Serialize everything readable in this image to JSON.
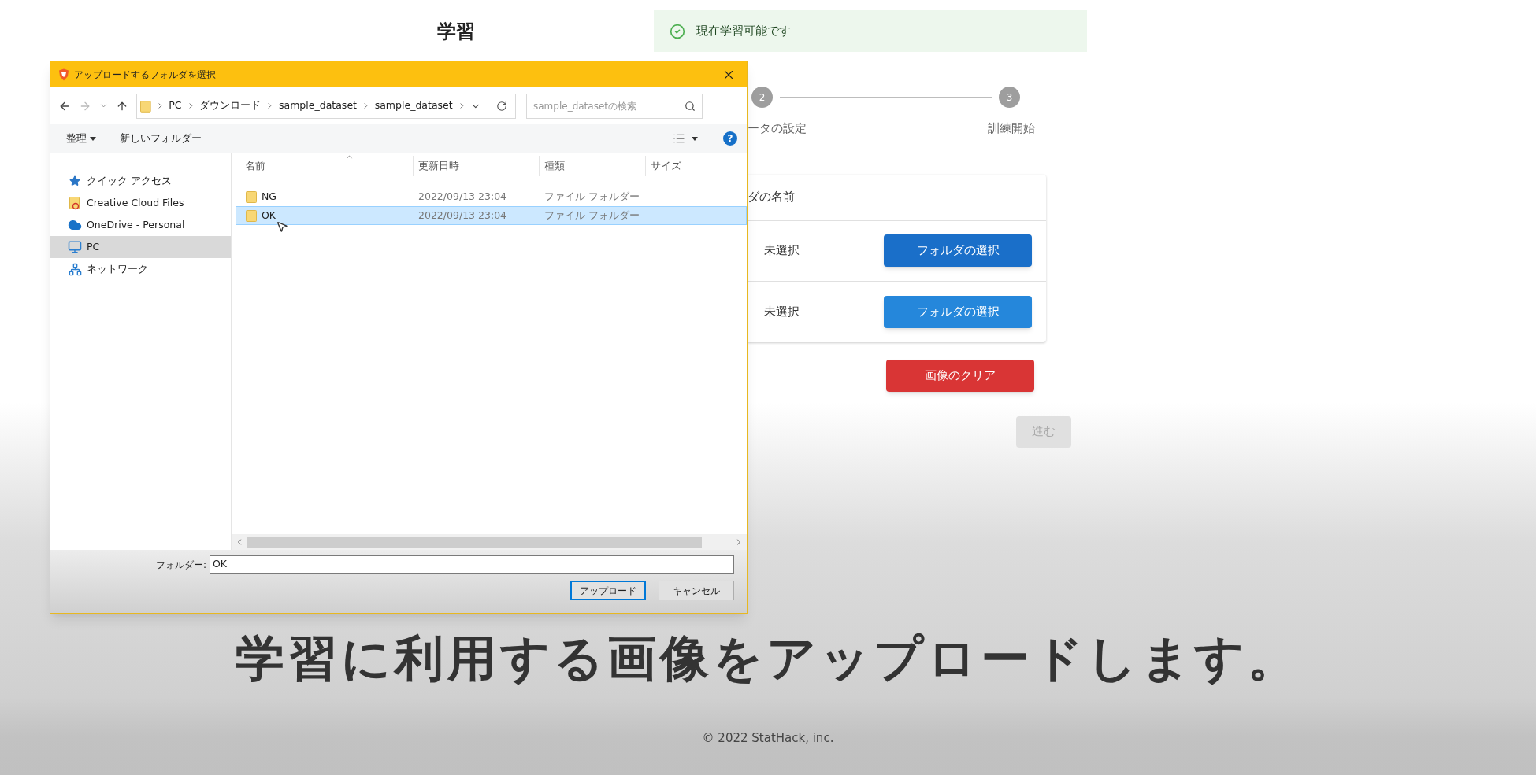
{
  "page": {
    "title": "学習",
    "status": "現在学習可能です"
  },
  "stepper": {
    "steps": [
      {
        "number": "2",
        "label": "ータの設定"
      },
      {
        "number": "3",
        "label": "訓練開始"
      }
    ]
  },
  "folder_card": {
    "header": "ダの名前",
    "rows": [
      {
        "value": "未選択",
        "button": "フォルダの選択",
        "hovered": true
      },
      {
        "value": "未選択",
        "button": "フォルダの選択",
        "hovered": false
      }
    ]
  },
  "clear_button": "画像のクリア",
  "next_button": {
    "label": "進む",
    "disabled": true
  },
  "dialog": {
    "title": "アップロードするフォルダを選択",
    "breadcrumbs": [
      "PC",
      "ダウンロード",
      "sample_dataset",
      "sample_dataset"
    ],
    "search_placeholder": "sample_datasetの検索",
    "toolbar": {
      "organize": "整理",
      "new_folder": "新しいフォルダー",
      "help": "?"
    },
    "sidebar": [
      {
        "label": "クイック アクセス",
        "kind": "star",
        "selected": false
      },
      {
        "label": "Creative Cloud Files",
        "kind": "cloud-folder",
        "selected": false
      },
      {
        "label": "OneDrive - Personal",
        "kind": "cloud",
        "selected": false
      },
      {
        "label": "PC",
        "kind": "monitor",
        "selected": true
      },
      {
        "label": "ネットワーク",
        "kind": "network",
        "selected": false
      }
    ],
    "columns": [
      "名前",
      "更新日時",
      "種類",
      "サイズ"
    ],
    "rows": [
      {
        "name": "NG",
        "modified": "2022/09/13 23:04",
        "type": "ファイル フォルダー",
        "selected": false
      },
      {
        "name": "OK",
        "modified": "2022/09/13 23:04",
        "type": "ファイル フォルダー",
        "selected": true
      }
    ],
    "folder_label": "フォルダー:",
    "folder_value": "OK",
    "buttons": [
      {
        "label": "アップロード",
        "default": true
      },
      {
        "label": "キャンセル",
        "default": false
      }
    ]
  },
  "subtitle": "学習に利用する画像をアップロードします。",
  "footer": "© 2022 StatHack, inc."
}
